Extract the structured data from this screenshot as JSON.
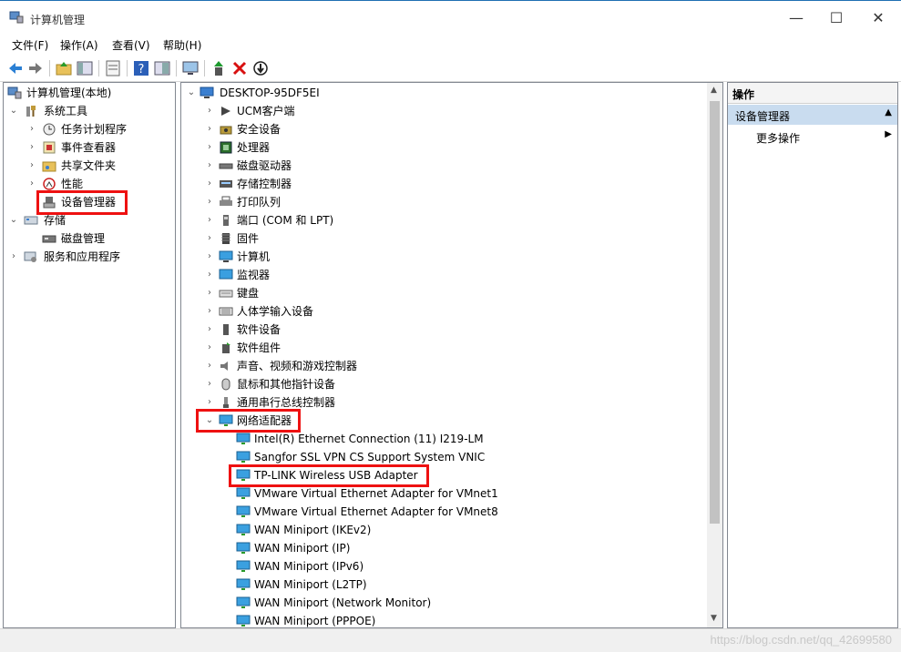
{
  "window": {
    "title": "计算机管理",
    "minimize": "—",
    "maximize": "☐",
    "close": "✕"
  },
  "menu": [
    "文件(F)",
    "操作(A)",
    "查看(V)",
    "帮助(H)"
  ],
  "toolbar": {
    "icons": [
      "back-icon",
      "forward-icon",
      "up-folder-icon",
      "show-hide-tree-icon",
      "properties-icon",
      "help-icon",
      "help-topics-icon",
      "monitor-icon",
      "update-driver-icon",
      "uninstall-icon",
      "disable-icon"
    ]
  },
  "tree": {
    "root": "计算机管理(本地)",
    "system_tools": "系统工具",
    "task_scheduler": "任务计划程序",
    "event_viewer": "事件查看器",
    "shared_folders": "共享文件夹",
    "performance": "性能",
    "device_manager": "设备管理器",
    "storage": "存储",
    "disk_management": "磁盘管理",
    "services_apps": "服务和应用程序"
  },
  "devices": {
    "computer_name": "DESKTOP-95DF5EI",
    "categories": [
      "UCM客户端",
      "安全设备",
      "处理器",
      "磁盘驱动器",
      "存储控制器",
      "打印队列",
      "端口 (COM 和 LPT)",
      "固件",
      "计算机",
      "监视器",
      "键盘",
      "人体学输入设备",
      "软件设备",
      "软件组件",
      "声音、视频和游戏控制器",
      "鼠标和其他指针设备",
      "通用串行总线控制器"
    ],
    "network_adapters_label": "网络适配器",
    "adapters": [
      "Intel(R) Ethernet Connection (11) I219-LM",
      "Sangfor SSL VPN CS Support System VNIC",
      "TP-LINK Wireless USB Adapter",
      "VMware Virtual Ethernet Adapter for VMnet1",
      "VMware Virtual Ethernet Adapter for VMnet8",
      "WAN Miniport (IKEv2)",
      "WAN Miniport (IP)",
      "WAN Miniport (IPv6)",
      "WAN Miniport (L2TP)",
      "WAN Miniport (Network Monitor)",
      "WAN Miniport (PPPOE)"
    ]
  },
  "actions": {
    "header": "操作",
    "section": "设备管理器",
    "more": "更多操作"
  },
  "watermark": "https://blog.csdn.net/qq_42699580",
  "colors": {
    "highlight": "#e11111",
    "action_section_bg": "#c9dcef"
  }
}
